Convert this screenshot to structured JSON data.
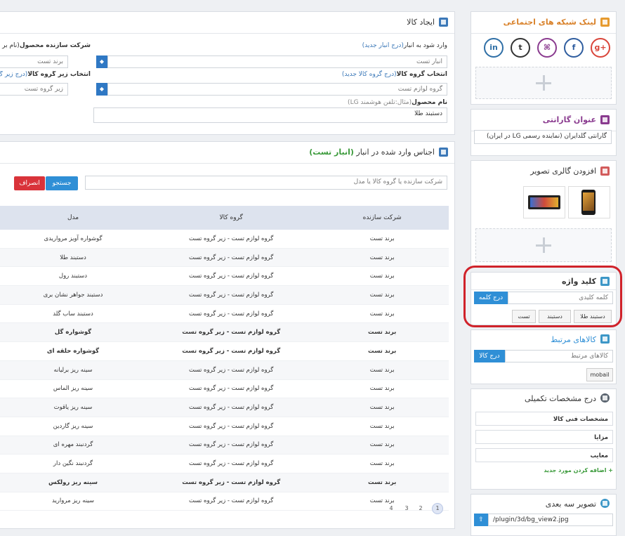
{
  "create_product": {
    "title": "ایجاد کالا",
    "warehouse_label": "وارد شود به انبار",
    "warehouse_hint": "(درج انبار جدید)",
    "warehouse_value": "انبار تست",
    "manufacturer_label": "شرکت سازنده محصول",
    "manufacturer_hint": "(نام بر",
    "manufacturer_value": "برند تست",
    "group_label": "انتخاب گروه کالا",
    "group_hint": "(درج گروه کالا جدید)",
    "group_value": "گروه لوازم تست",
    "subgroup_label": "انتخاب زیر گروه کالا",
    "subgroup_hint": "(درج زیر گ",
    "subgroup_value": "زیر گروه تست",
    "name_label": "نام محصول",
    "name_hint": "(مثال:تلفن هوشمند LG)",
    "name_value": "دستبند طلا"
  },
  "inventory": {
    "title": "اجناس وارد شده در انبار",
    "title_hint": "(انبار تست)",
    "search_placeholder": "شرکت سازنده یا  گروه کالا یا مدل",
    "search_button": "جستجو",
    "cancel_button": "انصراف",
    "columns": [
      "شرکت سازنده",
      "گروه کالا",
      "مدل"
    ],
    "rows": [
      [
        "برند تست",
        "گروه لوازم تست - زیر گروه تست",
        "گوشواره آویز مرواریدی"
      ],
      [
        "برند تست",
        "گروه لوازم تست - زیر گروه تست",
        "دستبند طلا"
      ],
      [
        "برند تست",
        "گروه لوازم تست - زیر گروه تست",
        "دستبند رول"
      ],
      [
        "برند تست",
        "گروه لوازم تست - زیر گروه تست",
        "دستبند جواهر نشان بری"
      ],
      [
        "برند تست",
        "گروه لوازم تست - زیر گروه تست",
        "دستبند ساب گلد"
      ],
      [
        "برند تست",
        "گروه لوازم تست - زیر گروه تست",
        "گوشواره گل"
      ],
      [
        "برند تست",
        "گروه لوازم تست - زیر گروه تست",
        "گوشواره حلقه ای"
      ],
      [
        "برند تست",
        "گروه لوازم تست - زیر گروه تست",
        "سینه ریز برلیانه"
      ],
      [
        "برند تست",
        "گروه لوازم تست - زیر گروه تست",
        "سینه ریز الماس"
      ],
      [
        "برند تست",
        "گروه لوازم تست - زیر گروه تست",
        "سینه ریز یاقوت"
      ],
      [
        "برند تست",
        "گروه لوازم تست - زیر گروه تست",
        "سینه ریز گاردین"
      ],
      [
        "برند تست",
        "گروه لوازم تست - زیر گروه تست",
        "گردنبند مهره ای"
      ],
      [
        "برند تست",
        "گروه لوازم تست - زیر گروه تست",
        "گردنبند نگین دار"
      ],
      [
        "برند تست",
        "گروه لوازم تست - زیر گروه تست",
        "سینه ریز رولکس"
      ],
      [
        "برند تست",
        "گروه لوازم تست - زیر گروه تست",
        "سینه ریز مروارید"
      ]
    ],
    "pages": [
      "1",
      "2",
      "3",
      "4"
    ]
  },
  "social": {
    "title": "لینک شبکه های اجتماعی",
    "icons": [
      "g+",
      "f",
      "⌘",
      "t",
      "in"
    ]
  },
  "warranty": {
    "title": "عنوان گارانتی",
    "value": "گارانتی گلدایران (نماینده رسمی LG در ایران)"
  },
  "gallery": {
    "title": "افزودن گالری تصویر"
  },
  "keywords": {
    "title": "کلید واژه",
    "placeholder": "کلمه کلیدی",
    "add_button": "درج کلمه",
    "tags": [
      "دستبند طلا",
      "دستبند",
      "تست"
    ]
  },
  "related": {
    "title": "کالاهای مرتبط",
    "placeholder": "کالاهای مرتبط",
    "add_button": "درج کالا",
    "tags": [
      "mobail"
    ]
  },
  "specs": {
    "title": "درج مشخصات تکمیلی",
    "items": [
      "مشخصات فنی کالا",
      "مزایا",
      "معایب"
    ],
    "add_link": "اضافه کردن مورد جدید"
  },
  "image3d": {
    "title": "تصویر سه بعدی",
    "path": "/plugin/3d/bg_view2.jpg",
    "upload_icon": "upload-icon"
  },
  "colors": {
    "accent": "#2f78c4",
    "danger": "#d9333a",
    "highlight": "#d0222a"
  }
}
